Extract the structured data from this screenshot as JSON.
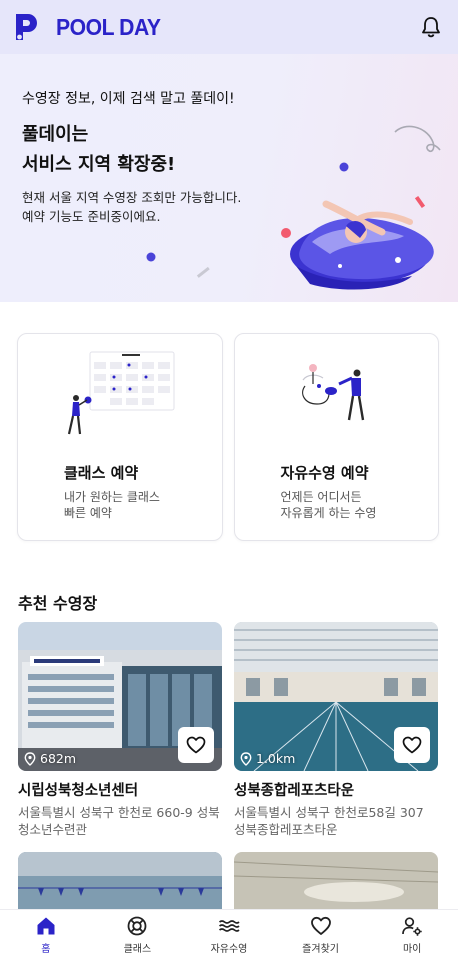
{
  "app": {
    "name": "POOL DAY"
  },
  "hero": {
    "eyebrow": "수영장 정보, 이제 검색 말고 풀데이!",
    "title_line1": "풀데이는",
    "title_line2": "서비스 지역 확장중!",
    "desc_line1": "현재 서울 지역 수영장 조회만 가능합니다.",
    "desc_line2": "예약 기능도 준비중이에요."
  },
  "services": [
    {
      "title": "클래스 예약",
      "sub_line1": "내가 원하는 클래스",
      "sub_line2": "빠른 예약"
    },
    {
      "title": "자유수영 예약",
      "sub_line1": "언제든 어디서든",
      "sub_line2": "자유롭게 하는 수영"
    }
  ],
  "recommended": {
    "title": "추천 수영장",
    "pools": [
      {
        "distance": "682m",
        "name": "시립성북청소년센터",
        "address": "서울특별시 성북구 한천로 660-9 성북청소년수련관"
      },
      {
        "distance": "1.0km",
        "name": "성북종합레포츠타운",
        "address": "서울특별시 성북구 한천로58길 307 성북종합레포츠타운"
      }
    ]
  },
  "tabs": [
    {
      "label": "홈",
      "icon": "home-icon",
      "active": true
    },
    {
      "label": "클래스",
      "icon": "lifebuoy-icon",
      "active": false
    },
    {
      "label": "자유수영",
      "icon": "waves-icon",
      "active": false
    },
    {
      "label": "즐겨찾기",
      "icon": "heart-icon",
      "active": false
    },
    {
      "label": "마이",
      "icon": "user-settings-icon",
      "active": false
    }
  ],
  "colors": {
    "brand": "#2b23c8",
    "hero_bg": "#eeeefc",
    "header_bg": "#e6e6fa"
  }
}
